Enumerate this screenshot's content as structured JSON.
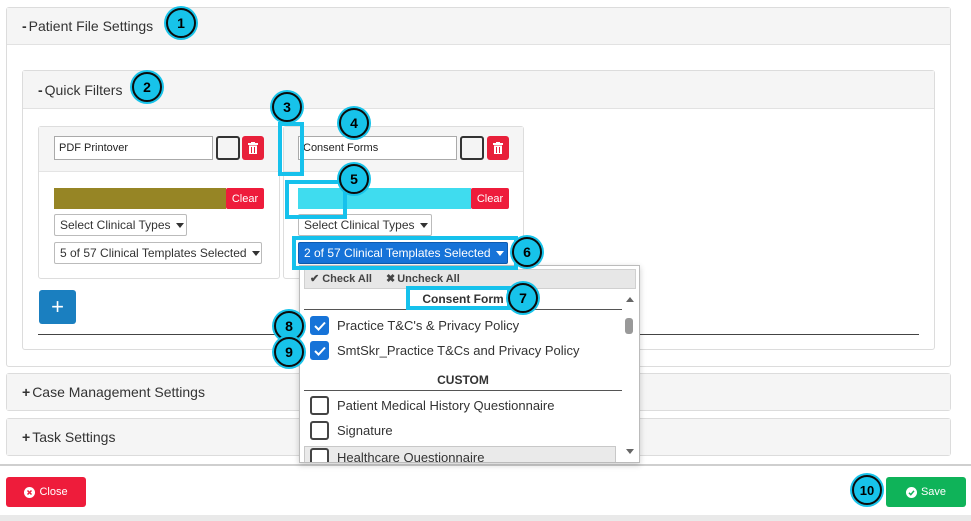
{
  "sections": {
    "patient_file": {
      "sign": "-",
      "title": "Patient File Settings"
    },
    "quick_filters": {
      "sign": "-",
      "title": "Quick Filters"
    },
    "case_management": {
      "sign": "+",
      "title": "Case Management Settings"
    },
    "task_settings": {
      "sign": "+",
      "title": "Task Settings"
    }
  },
  "filters": [
    {
      "name": "PDF Printover",
      "color": "#968525",
      "clear_label": "Clear",
      "clinical_types": "Select Clinical Types",
      "templates": "5 of 57 Clinical Templates Selected"
    },
    {
      "name": "Consent Forms",
      "color": "#3fdcef",
      "clear_label": "Clear",
      "clinical_types": "Select Clinical Types",
      "templates": "2 of 57 Clinical Templates Selected"
    }
  ],
  "add_filter_label": "+",
  "menu": {
    "check_all": "Check All",
    "uncheck_all": "Uncheck All",
    "groups": [
      {
        "title": "Consent Form",
        "items": [
          {
            "label": "Practice T&C's & Privacy Policy",
            "checked": true
          },
          {
            "label": "SmtSkr_Practice T&Cs and Privacy Policy",
            "checked": true
          }
        ]
      },
      {
        "title": "CUSTOM",
        "items": [
          {
            "label": "Patient Medical History Questionnaire",
            "checked": false
          },
          {
            "label": "Signature",
            "checked": false
          },
          {
            "label": "Healthcare Questionnaire",
            "checked": false
          }
        ]
      }
    ]
  },
  "footer": {
    "close_label": "Close",
    "save_label": "Save"
  },
  "callouts": [
    "1",
    "2",
    "3",
    "4",
    "5",
    "6",
    "7",
    "8",
    "9",
    "10"
  ],
  "colors": {
    "accent": "#1673d8",
    "callout": "#17c3ea",
    "danger": "#ee1c3b",
    "success": "#0fb359"
  }
}
